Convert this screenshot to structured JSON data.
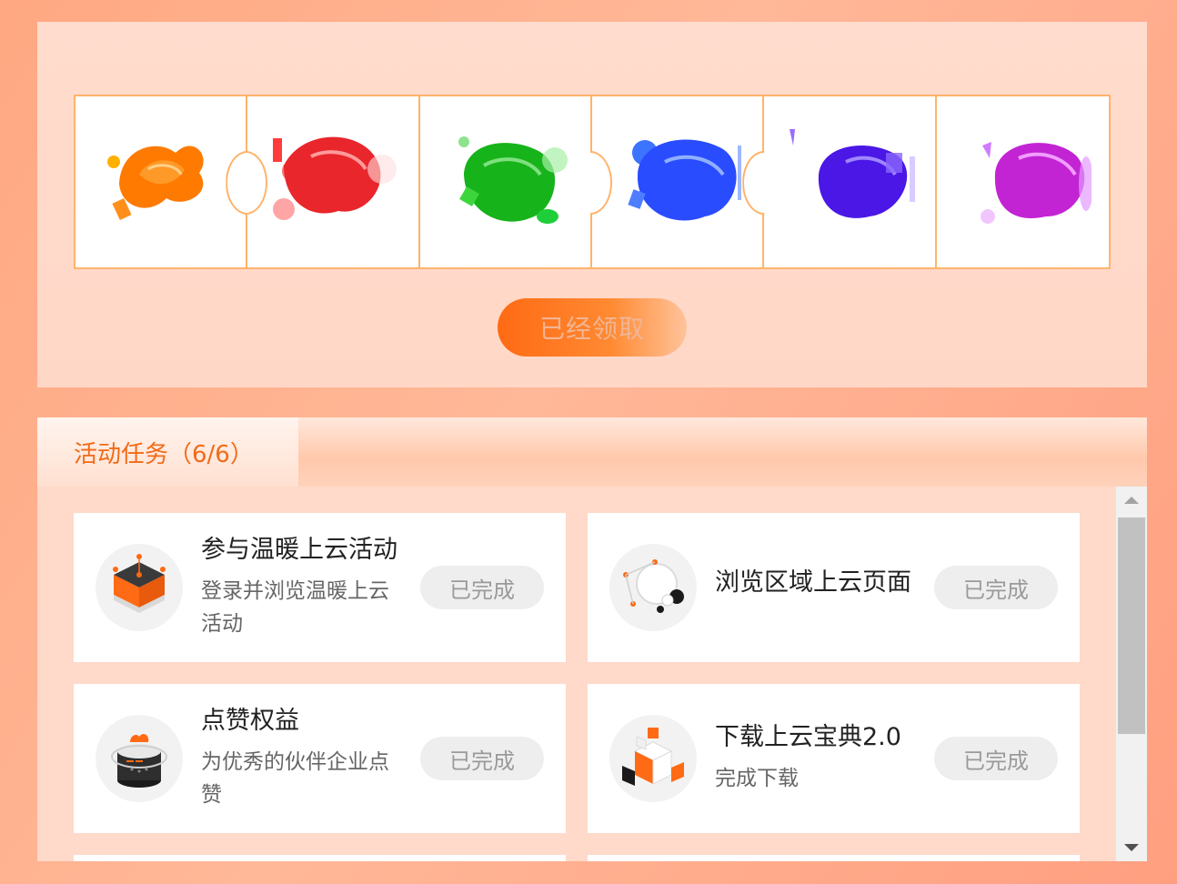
{
  "puzzle": {
    "pieces": [
      {
        "icon": "orange-swirl-art",
        "color": "#ff7a00"
      },
      {
        "icon": "red-swirl-art",
        "color": "#e8262c"
      },
      {
        "icon": "green-swirl-art",
        "color": "#17b31b"
      },
      {
        "icon": "blue-swirl-art",
        "color": "#2a4cff"
      },
      {
        "icon": "indigo-swirl-art",
        "color": "#4b17e6"
      },
      {
        "icon": "purple-swirl-art",
        "color": "#c224d4"
      }
    ],
    "claim_button_label": "已经领取"
  },
  "tasks_panel": {
    "tab_label": "活动任务（6/6）",
    "tasks": [
      {
        "title": "参与温暖上云活动",
        "desc": "登录并浏览温暖上云活动",
        "button": "已完成",
        "icon": "cube-platform-icon"
      },
      {
        "title": "浏览区域上云页面",
        "desc": "",
        "button": "已完成",
        "icon": "spheres-network-icon"
      },
      {
        "title": "点赞权益",
        "desc": "为优秀的伙伴企业点赞",
        "button": "已完成",
        "icon": "cloud-device-icon"
      },
      {
        "title": "下载上云宝典2.0",
        "desc": "完成下载",
        "button": "已完成",
        "icon": "blocks-cube-icon"
      }
    ]
  },
  "colors": {
    "accent": "#f26a17",
    "puzzle_border": "#ffb36b",
    "done_button_bg": "#eeeeee"
  }
}
